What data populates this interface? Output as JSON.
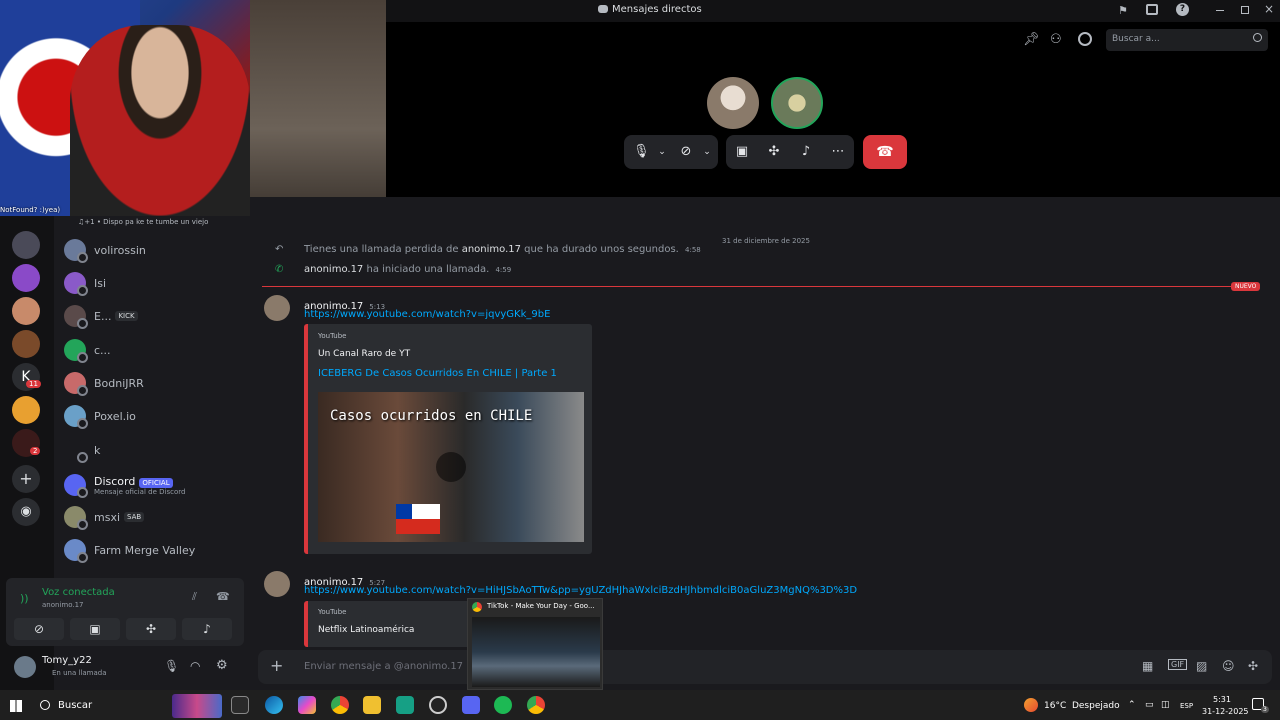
{
  "window": {
    "title": "Mensajes directos"
  },
  "webcam": {
    "caption": "NotFound? :)yea)"
  },
  "header": {
    "search_placeholder": "Buscar a..."
  },
  "call": {
    "controls": [
      "microphone-icon",
      "camera-off-icon",
      "screen-share-icon",
      "activities-icon",
      "soundboard-icon",
      "more-icon"
    ]
  },
  "now_playing": "♫+1 • Dispo pa ke te tumbe un viejo",
  "dm_list": [
    {
      "name": "volirossin"
    },
    {
      "name": "Isi"
    },
    {
      "name": "E...",
      "badge": "KICK"
    },
    {
      "name": "c..."
    },
    {
      "name": "BodniJRR"
    },
    {
      "name": "Poxel.io"
    },
    {
      "name": "k"
    },
    {
      "name": "Discord",
      "badge": "OFICIAL",
      "sub": "Mensaje oficial de Discord"
    },
    {
      "name": "msxi",
      "badge": "SAB"
    },
    {
      "name": "Farm Merge Valley"
    }
  ],
  "server_badges": [
    "11",
    "2"
  ],
  "voice": {
    "status": "Voz conectada",
    "channel": "anonimo.17"
  },
  "user": {
    "name": "Tomy_y22",
    "status": "En una llamada"
  },
  "chat": {
    "date_divider": "31 de diciembre de 2025",
    "new_label": "NUEVO",
    "missed": {
      "prefix": "Tienes una llamada perdida de ",
      "who": "anonimo.17",
      "suffix": " que ha durado unos segundos.",
      "time": "4:58"
    },
    "started": {
      "who": "anonimo.17",
      "text": " ha iniciado una llamada.",
      "time": "4:59"
    },
    "messages": [
      {
        "author": "anonimo.17",
        "time": "5:13",
        "link": "https://www.youtube.com/watch?v=jqvyGKk_9bE",
        "embed": {
          "provider": "YouTube",
          "channel": "Un Canal Raro de YT",
          "title": "ICEBERG De Casos Ocurridos En CHILE | Parte 1",
          "thumb_text": "Casos ocurridos en CHILE"
        }
      },
      {
        "author": "anonimo.17",
        "time": "5:27",
        "link": "https://www.youtube.com/watch?v=HiHJSbAoTTw&pp=ygUZdHJhaWxlciBzdHJhbmdlciB0aGluZ3MgNQ%3D%3D",
        "embed": {
          "provider": "YouTube",
          "channel": "Netflix Latinoamérica"
        }
      }
    ],
    "composer_placeholder": "Enviar mensaje a @anonimo.17"
  },
  "taskbar": {
    "search": "Buscar",
    "weather": "16°C  Despejado",
    "lang": "ESP",
    "time": "5:31",
    "date": "31-12-2025",
    "notif_count": "3",
    "preview_title": "TikTok - Make Your Day - Goo..."
  }
}
